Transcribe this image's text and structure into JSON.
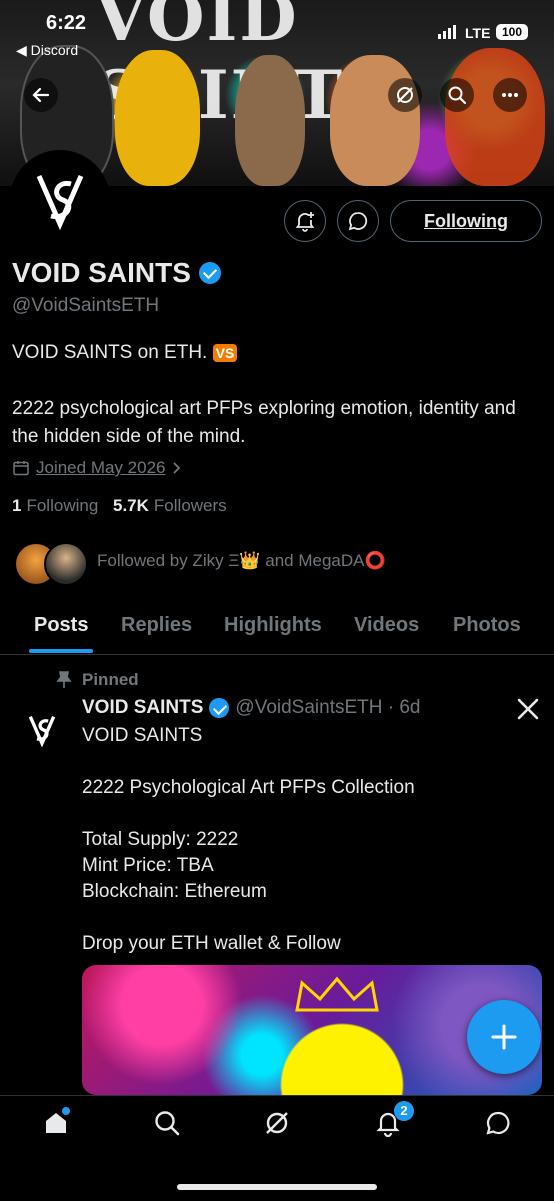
{
  "status_bar": {
    "time": "6:22",
    "back_app": "◀ Discord",
    "network": "LTE",
    "battery": "100"
  },
  "banner": {
    "title_art": "VOID SAINTS"
  },
  "actions": {
    "following_label": "Following"
  },
  "profile": {
    "name": "VOID SAINTS",
    "handle": "@VoidSaintsETH",
    "bio_line1": "VOID SAINTS on ETH.",
    "bio_emoji": "VS",
    "bio_line2": "2222 psychological art PFPs exploring emotion, identity and the hidden side of the mind.",
    "joined": "Joined May 2026",
    "following_count": "1",
    "following_label": "Following",
    "followers_count": "5.7K",
    "followers_label": "Followers",
    "followed_by": "Followed by Ziky Ξ👑 and MegaDA⭕"
  },
  "tabs": [
    {
      "label": "Posts"
    },
    {
      "label": "Replies"
    },
    {
      "label": "Highlights"
    },
    {
      "label": "Videos"
    },
    {
      "label": "Photos"
    }
  ],
  "post": {
    "pinned_label": "Pinned",
    "author": "VOID SAINTS",
    "handle_time": "@VoidSaintsETH · 6d",
    "lines": [
      "VOID SAINTS",
      "2222 Psychological Art PFPs Collection",
      "Total Supply: 2222",
      "Mint Price: TBA",
      "Blockchain: Ethereum",
      "Drop your ETH wallet & Follow"
    ]
  },
  "bottom_nav": {
    "notifications_badge": "2"
  },
  "colors": {
    "accent": "#1d9bf0",
    "text": "#e7e9ea",
    "muted": "#71767b",
    "background": "#000000"
  }
}
